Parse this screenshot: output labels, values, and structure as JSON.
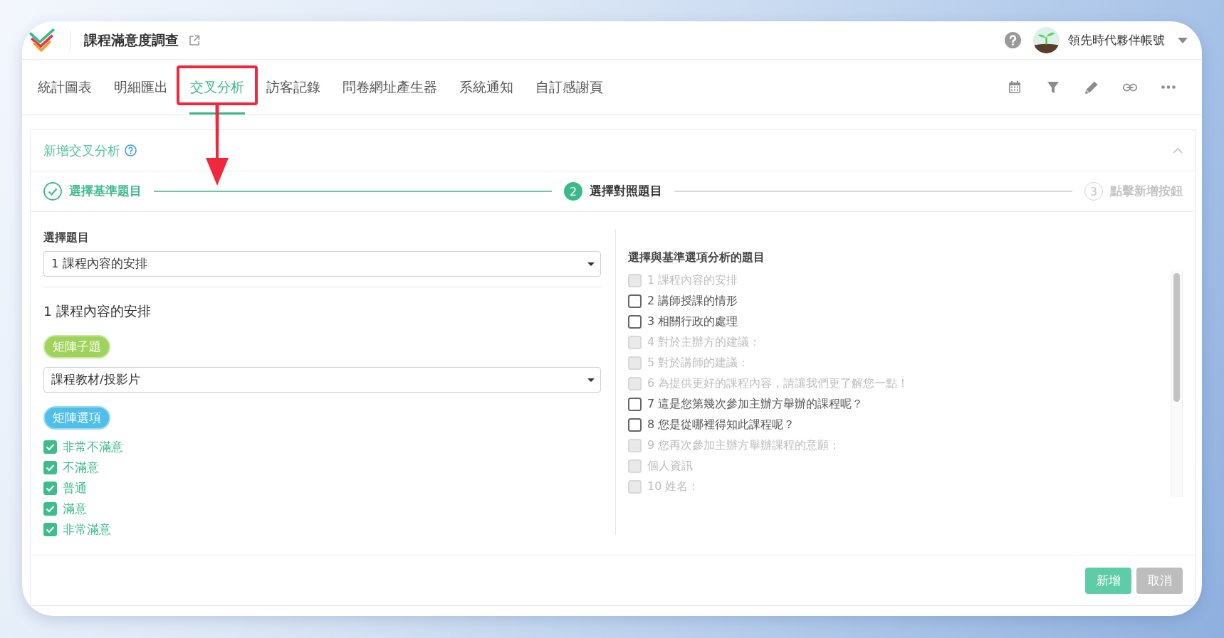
{
  "header": {
    "title": "課程滿意度調查",
    "account": "領先時代夥伴帳號"
  },
  "tabs": [
    {
      "label": "統計圖表",
      "selected": false,
      "highlighted": false
    },
    {
      "label": "明細匯出",
      "selected": false,
      "highlighted": false
    },
    {
      "label": "交叉分析",
      "selected": true,
      "highlighted": true
    },
    {
      "label": "訪客記錄",
      "selected": false,
      "highlighted": false
    },
    {
      "label": "問卷網址產生器",
      "selected": false,
      "highlighted": false
    },
    {
      "label": "系統通知",
      "selected": false,
      "highlighted": false
    },
    {
      "label": "自訂感謝頁",
      "selected": false,
      "highlighted": false
    }
  ],
  "panel": {
    "title": "新增交叉分析",
    "expanded": true,
    "steps": [
      {
        "label": "選擇基準題目",
        "done": true,
        "current": false
      },
      {
        "number": "2",
        "label": "選擇對照題目",
        "done": false,
        "current": true
      },
      {
        "number": "3",
        "label": "點擊新增按鈕",
        "done": false,
        "current": false
      }
    ],
    "base": {
      "label": "選擇題目",
      "question": "1 課程內容的安排",
      "question_title": "1 課程內容的安排",
      "sub_badge": "矩陣子題",
      "sub_question": "課程教材/投影片",
      "options_badge": "矩陣選項",
      "options": [
        {
          "label": "非常不滿意",
          "checked": true
        },
        {
          "label": "不滿意",
          "checked": true
        },
        {
          "label": "普通",
          "checked": true
        },
        {
          "label": "滿意",
          "checked": true
        },
        {
          "label": "非常滿意",
          "checked": true
        }
      ]
    },
    "compare": {
      "title": "選擇與基準選項分析的題目",
      "questions": [
        {
          "label": "1 課程內容的安排",
          "checked": false,
          "disabled": true
        },
        {
          "label": "2 講師授課的情形",
          "checked": false,
          "disabled": false
        },
        {
          "label": "3 相關行政的處理",
          "checked": false,
          "disabled": false
        },
        {
          "label": "4 對於主辦方的建議：",
          "checked": false,
          "disabled": true
        },
        {
          "label": "5 對於講師的建議：",
          "checked": false,
          "disabled": true
        },
        {
          "label": "6 為提供更好的課程內容，請讓我們更了解您一點！",
          "checked": false,
          "disabled": true
        },
        {
          "label": "7 這是您第幾次參加主辦方舉辦的課程呢？",
          "checked": false,
          "disabled": false
        },
        {
          "label": "8 您是從哪裡得知此課程呢？",
          "checked": false,
          "disabled": false
        },
        {
          "label": "9 您再次參加主辦方舉辦課程的意願：",
          "checked": false,
          "disabled": true
        },
        {
          "label": "個人資訊",
          "checked": false,
          "disabled": true
        },
        {
          "label": "10 姓名：",
          "checked": false,
          "disabled": true
        }
      ]
    },
    "actions": [
      {
        "label": "新增",
        "kind": "primary"
      },
      {
        "label": "取消",
        "kind": "secondary"
      }
    ]
  }
}
